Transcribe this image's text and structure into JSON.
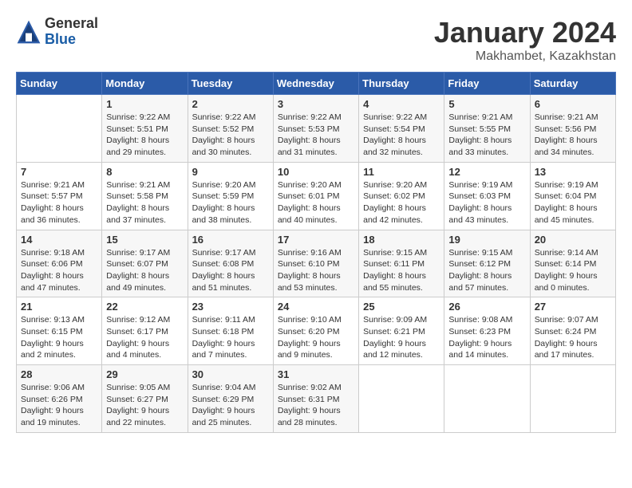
{
  "logo": {
    "general": "General",
    "blue": "Blue"
  },
  "title": "January 2024",
  "subtitle": "Makhambet, Kazakhstan",
  "days_header": [
    "Sunday",
    "Monday",
    "Tuesday",
    "Wednesday",
    "Thursday",
    "Friday",
    "Saturday"
  ],
  "weeks": [
    [
      {
        "day": "",
        "info": ""
      },
      {
        "day": "1",
        "info": "Sunrise: 9:22 AM\nSunset: 5:51 PM\nDaylight: 8 hours\nand 29 minutes."
      },
      {
        "day": "2",
        "info": "Sunrise: 9:22 AM\nSunset: 5:52 PM\nDaylight: 8 hours\nand 30 minutes."
      },
      {
        "day": "3",
        "info": "Sunrise: 9:22 AM\nSunset: 5:53 PM\nDaylight: 8 hours\nand 31 minutes."
      },
      {
        "day": "4",
        "info": "Sunrise: 9:22 AM\nSunset: 5:54 PM\nDaylight: 8 hours\nand 32 minutes."
      },
      {
        "day": "5",
        "info": "Sunrise: 9:21 AM\nSunset: 5:55 PM\nDaylight: 8 hours\nand 33 minutes."
      },
      {
        "day": "6",
        "info": "Sunrise: 9:21 AM\nSunset: 5:56 PM\nDaylight: 8 hours\nand 34 minutes."
      }
    ],
    [
      {
        "day": "7",
        "info": "Sunrise: 9:21 AM\nSunset: 5:57 PM\nDaylight: 8 hours\nand 36 minutes."
      },
      {
        "day": "8",
        "info": "Sunrise: 9:21 AM\nSunset: 5:58 PM\nDaylight: 8 hours\nand 37 minutes."
      },
      {
        "day": "9",
        "info": "Sunrise: 9:20 AM\nSunset: 5:59 PM\nDaylight: 8 hours\nand 38 minutes."
      },
      {
        "day": "10",
        "info": "Sunrise: 9:20 AM\nSunset: 6:01 PM\nDaylight: 8 hours\nand 40 minutes."
      },
      {
        "day": "11",
        "info": "Sunrise: 9:20 AM\nSunset: 6:02 PM\nDaylight: 8 hours\nand 42 minutes."
      },
      {
        "day": "12",
        "info": "Sunrise: 9:19 AM\nSunset: 6:03 PM\nDaylight: 8 hours\nand 43 minutes."
      },
      {
        "day": "13",
        "info": "Sunrise: 9:19 AM\nSunset: 6:04 PM\nDaylight: 8 hours\nand 45 minutes."
      }
    ],
    [
      {
        "day": "14",
        "info": "Sunrise: 9:18 AM\nSunset: 6:06 PM\nDaylight: 8 hours\nand 47 minutes."
      },
      {
        "day": "15",
        "info": "Sunrise: 9:17 AM\nSunset: 6:07 PM\nDaylight: 8 hours\nand 49 minutes."
      },
      {
        "day": "16",
        "info": "Sunrise: 9:17 AM\nSunset: 6:08 PM\nDaylight: 8 hours\nand 51 minutes."
      },
      {
        "day": "17",
        "info": "Sunrise: 9:16 AM\nSunset: 6:10 PM\nDaylight: 8 hours\nand 53 minutes."
      },
      {
        "day": "18",
        "info": "Sunrise: 9:15 AM\nSunset: 6:11 PM\nDaylight: 8 hours\nand 55 minutes."
      },
      {
        "day": "19",
        "info": "Sunrise: 9:15 AM\nSunset: 6:12 PM\nDaylight: 8 hours\nand 57 minutes."
      },
      {
        "day": "20",
        "info": "Sunrise: 9:14 AM\nSunset: 6:14 PM\nDaylight: 9 hours\nand 0 minutes."
      }
    ],
    [
      {
        "day": "21",
        "info": "Sunrise: 9:13 AM\nSunset: 6:15 PM\nDaylight: 9 hours\nand 2 minutes."
      },
      {
        "day": "22",
        "info": "Sunrise: 9:12 AM\nSunset: 6:17 PM\nDaylight: 9 hours\nand 4 minutes."
      },
      {
        "day": "23",
        "info": "Sunrise: 9:11 AM\nSunset: 6:18 PM\nDaylight: 9 hours\nand 7 minutes."
      },
      {
        "day": "24",
        "info": "Sunrise: 9:10 AM\nSunset: 6:20 PM\nDaylight: 9 hours\nand 9 minutes."
      },
      {
        "day": "25",
        "info": "Sunrise: 9:09 AM\nSunset: 6:21 PM\nDaylight: 9 hours\nand 12 minutes."
      },
      {
        "day": "26",
        "info": "Sunrise: 9:08 AM\nSunset: 6:23 PM\nDaylight: 9 hours\nand 14 minutes."
      },
      {
        "day": "27",
        "info": "Sunrise: 9:07 AM\nSunset: 6:24 PM\nDaylight: 9 hours\nand 17 minutes."
      }
    ],
    [
      {
        "day": "28",
        "info": "Sunrise: 9:06 AM\nSunset: 6:26 PM\nDaylight: 9 hours\nand 19 minutes."
      },
      {
        "day": "29",
        "info": "Sunrise: 9:05 AM\nSunset: 6:27 PM\nDaylight: 9 hours\nand 22 minutes."
      },
      {
        "day": "30",
        "info": "Sunrise: 9:04 AM\nSunset: 6:29 PM\nDaylight: 9 hours\nand 25 minutes."
      },
      {
        "day": "31",
        "info": "Sunrise: 9:02 AM\nSunset: 6:31 PM\nDaylight: 9 hours\nand 28 minutes."
      },
      {
        "day": "",
        "info": ""
      },
      {
        "day": "",
        "info": ""
      },
      {
        "day": "",
        "info": ""
      }
    ]
  ]
}
